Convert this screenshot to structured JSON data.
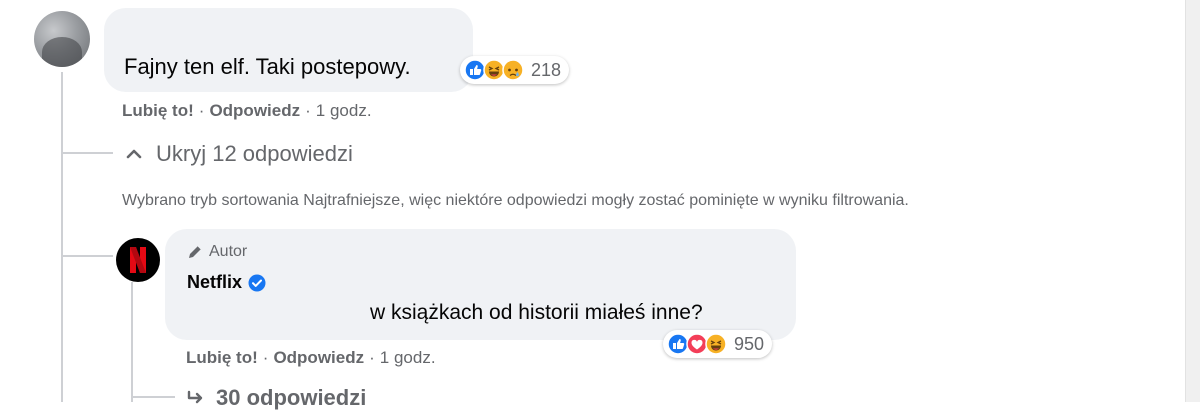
{
  "comment": {
    "text": "Fajny ten elf. Taki postepowy.",
    "reaction_icons": [
      "like-icon",
      "haha-icon",
      "sad-icon"
    ],
    "reaction_count": "218",
    "actions": {
      "like": "Lubię to!",
      "reply": "Odpowiedz",
      "separator": "·",
      "time": "1 godz."
    }
  },
  "replies_toggle": {
    "label": "Ukryj 12 odpowiedzi",
    "icon": "chevron-up-icon"
  },
  "sort_notice": "Wybrano tryb sortowania Najtrafniejsze, więc niektóre odpowiedzi mogły zostać pominięte w wyniku filtrowania.",
  "reply": {
    "badge": "Autor",
    "author": "Netflix",
    "text": "w książkach od historii miałeś inne?",
    "reaction_icons": [
      "like-icon",
      "love-icon",
      "haha-icon"
    ],
    "reaction_count": "950",
    "actions": {
      "like": "Lubię to!",
      "reply": "Odpowiedz",
      "separator": "·",
      "time": "1 godz."
    }
  },
  "more_replies": {
    "label": "30 odpowiedzi",
    "icon": "reply-arrow-icon"
  },
  "colors": {
    "bubble": "#f0f2f5",
    "secondary_text": "#65676b",
    "like_blue": "#1877f2",
    "love_red": "#f33e58",
    "haha_yellow": "#f7b125",
    "netflix_red": "#e50914"
  }
}
